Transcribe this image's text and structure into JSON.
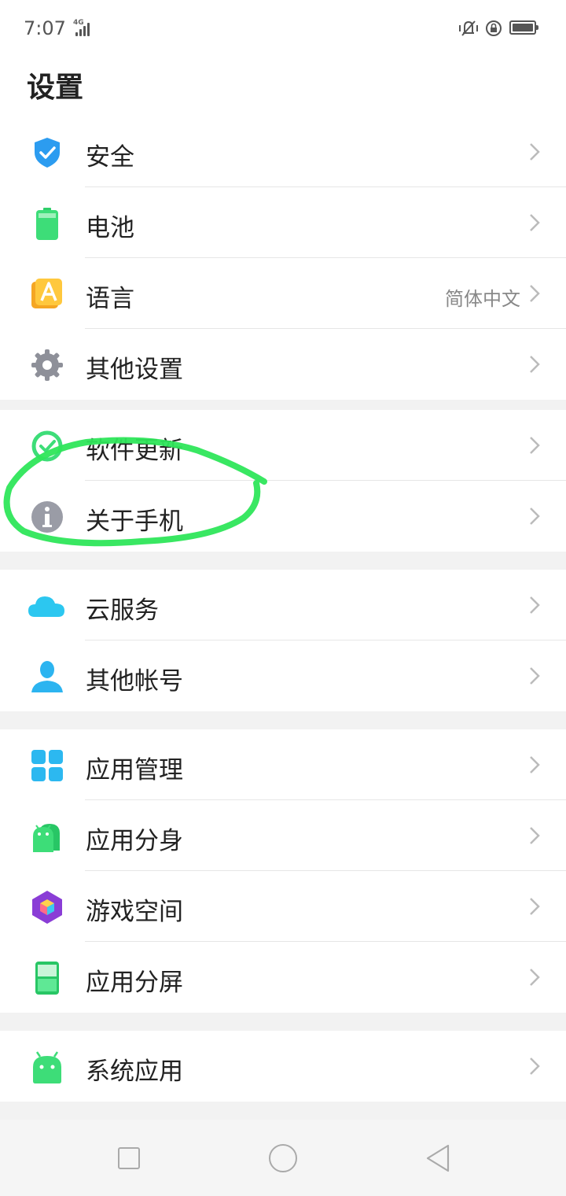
{
  "status": {
    "time": "7:07",
    "network": "4G"
  },
  "header": {
    "title": "设置"
  },
  "groups": [
    {
      "items": [
        {
          "label": "安全",
          "icon": "shield-check-icon"
        },
        {
          "label": "电池",
          "icon": "battery-icon"
        },
        {
          "label": "语言",
          "value": "简体中文",
          "icon": "language-icon"
        },
        {
          "label": "其他设置",
          "icon": "gear-icon"
        }
      ]
    },
    {
      "items": [
        {
          "label": "软件更新",
          "icon": "update-icon"
        },
        {
          "label": "关于手机",
          "icon": "info-icon"
        }
      ]
    },
    {
      "items": [
        {
          "label": "云服务",
          "icon": "cloud-icon"
        },
        {
          "label": "其他帐号",
          "icon": "user-icon"
        }
      ]
    },
    {
      "items": [
        {
          "label": "应用管理",
          "icon": "app-grid-icon"
        },
        {
          "label": "应用分身",
          "icon": "android-clone-icon"
        },
        {
          "label": "游戏空间",
          "icon": "game-cube-icon"
        },
        {
          "label": "应用分屏",
          "icon": "split-screen-icon"
        }
      ]
    },
    {
      "items": [
        {
          "label": "系统应用",
          "icon": "android-icon"
        }
      ]
    }
  ],
  "colors": {
    "accent_green": "#2ee65a",
    "chevron": "#bbbbbb"
  }
}
